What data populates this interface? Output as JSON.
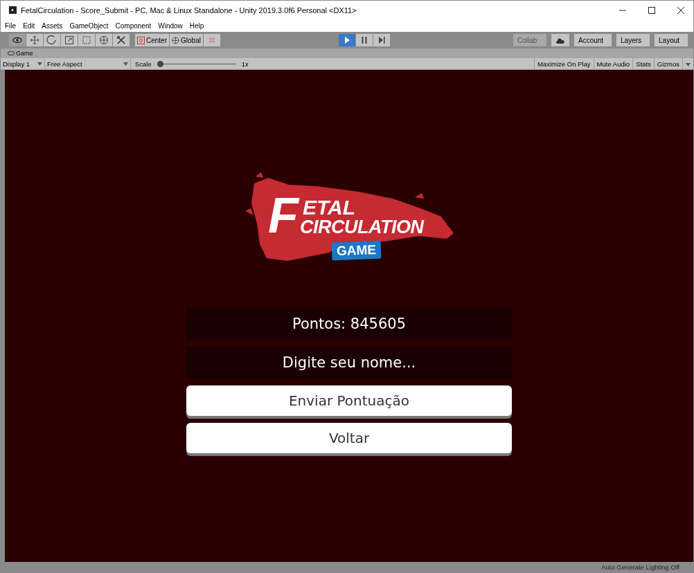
{
  "window": {
    "title": "FetalCirculation - Score_Submit - PC, Mac & Linux Standalone - Unity 2019.3.0f6 Personal <DX11>"
  },
  "menu": [
    "File",
    "Edit",
    "Assets",
    "GameObject",
    "Component",
    "Window",
    "Help"
  ],
  "toolbar": {
    "tools": [
      {
        "kind": "view",
        "selected": true
      },
      {
        "kind": "move",
        "selected": false
      },
      {
        "kind": "rotate",
        "selected": false
      },
      {
        "kind": "scale",
        "selected": false
      },
      {
        "kind": "rect",
        "selected": false
      },
      {
        "kind": "transform",
        "selected": false
      },
      {
        "kind": "custom",
        "selected": false
      }
    ],
    "pivot": [
      "Center",
      "Global"
    ],
    "playback": [
      {
        "kind": "play",
        "on": true
      },
      {
        "kind": "pause",
        "on": false
      },
      {
        "kind": "step",
        "on": false
      }
    ],
    "collab": {
      "label": "Collab",
      "disabled": true
    },
    "dropdowns": [
      "Account",
      "Layers",
      "Layout"
    ]
  },
  "game_tab": {
    "label": "Game"
  },
  "game_toolbar": {
    "display": "Display 1",
    "aspect": "Free Aspect",
    "scale_label": "Scale",
    "scale": {
      "level": 0.0
    },
    "scale_value": "1x",
    "toggles": [
      {
        "label": "Maximize On Play",
        "on": false
      },
      {
        "label": "Mute Audio",
        "on": false
      },
      {
        "label": "Stats",
        "on": false
      },
      {
        "label": "Gizmos",
        "on": false
      }
    ]
  },
  "logo": {
    "big_letter": "F",
    "line_1": "ETAL",
    "line_2": "CIRCULATION",
    "badge": "GAME"
  },
  "score": "Pontos: 845605",
  "name_field": {
    "placeholder": "Digite seu nome..."
  },
  "buttons": [
    "Enviar Pontuação",
    "Voltar"
  ],
  "status_bar": "Auto Generate Lighting Off"
}
